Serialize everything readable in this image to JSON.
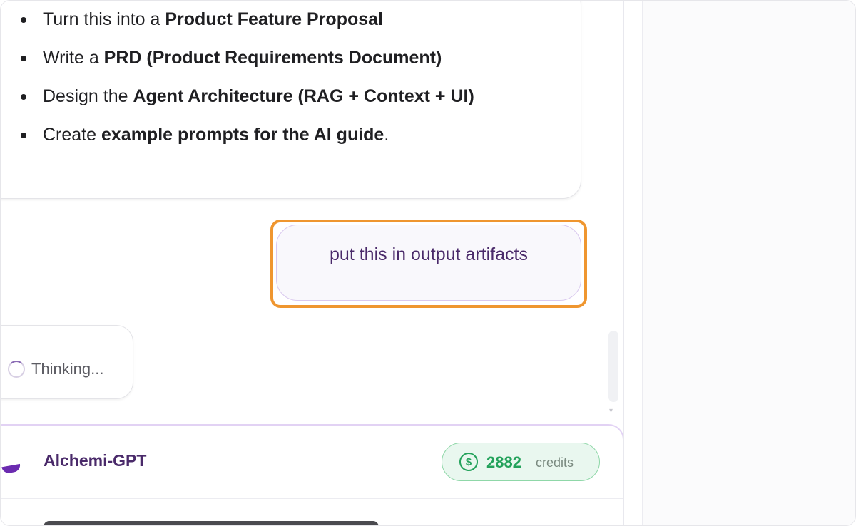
{
  "assistant_message": {
    "bullets": [
      {
        "prefix": "Turn this into a ",
        "bold": "Product Feature Proposal",
        "suffix": ""
      },
      {
        "prefix": "Write a ",
        "bold": "PRD (Product Requirements Document)",
        "suffix": ""
      },
      {
        "prefix": "Design the ",
        "bold": "Agent Architecture (RAG + Context + UI)",
        "suffix": ""
      },
      {
        "prefix": "Create ",
        "bold": "example prompts for the AI guide",
        "suffix": "."
      }
    ]
  },
  "user_message": {
    "text": "put this in output artifacts"
  },
  "status": {
    "thinking_label": "Thinking..."
  },
  "composer": {
    "model_name": "Alchemi-GPT",
    "credits_value": "2882",
    "credits_label": "credits",
    "credits_icon": "dollar-coin-icon"
  },
  "colors": {
    "highlight": "#ef962f",
    "accent_purple": "#6b2bb0",
    "credits_green": "#23a25b"
  }
}
